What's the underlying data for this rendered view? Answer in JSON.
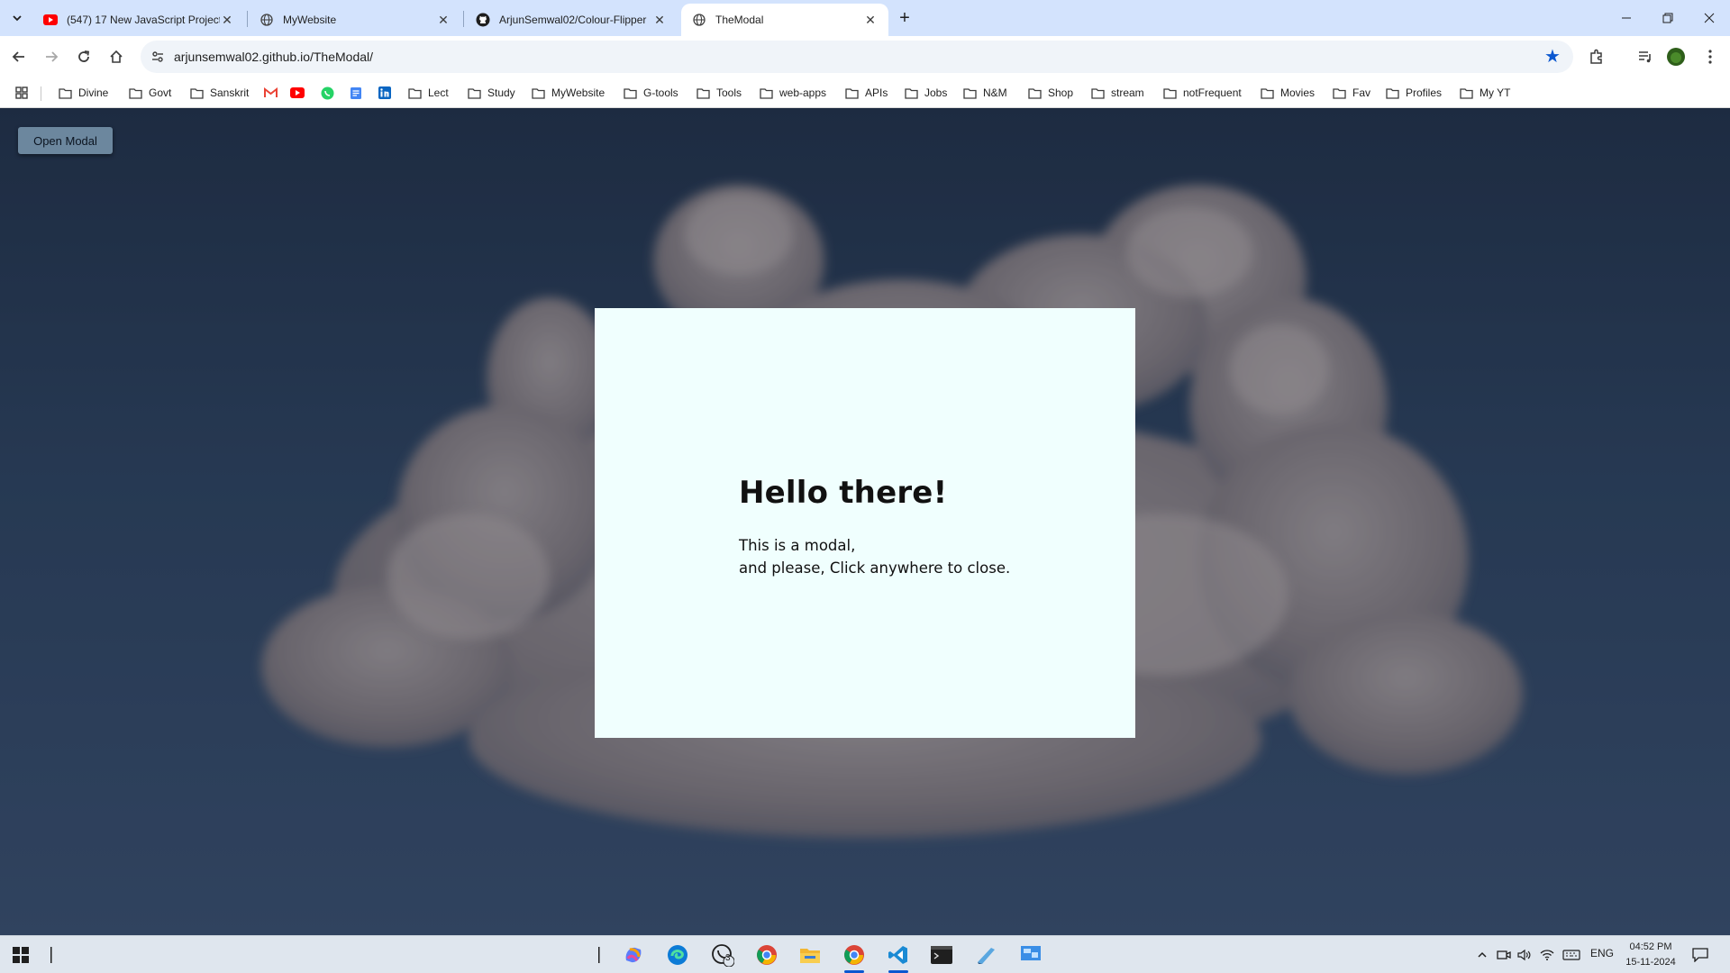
{
  "browser": {
    "tabs": [
      {
        "title": "(547) 17 New JavaScript Project",
        "icon": "youtube-icon"
      },
      {
        "title": "MyWebsite",
        "icon": "globe-icon"
      },
      {
        "title": "ArjunSemwal02/Colour-Flipper",
        "icon": "github-icon"
      },
      {
        "title": "TheModal",
        "icon": "globe-icon",
        "active": true
      }
    ],
    "url": "arjunsemwal02.github.io/TheModal/",
    "bookmarks": [
      "Divine",
      "Govt",
      "Sanskrit",
      "Lect",
      "Study",
      "MyWebsite",
      "G-tools",
      "Tools",
      "web-apps",
      "APIs",
      "Jobs",
      "N&M",
      "Shop",
      "stream",
      "notFrequent",
      "Movies",
      "Fav",
      "Profiles",
      "My YT"
    ]
  },
  "page": {
    "open_button": "Open Modal",
    "modal": {
      "heading": "Hello there!",
      "line1": "This is a modal,",
      "line2": "and please, Click anywhere to close."
    }
  },
  "taskbar": {
    "whatsapp_badge": "3",
    "language": "ENG",
    "time": "04:52 PM",
    "date": "15-11-2024"
  },
  "colors": {
    "tabstrip": "#d3e3fd",
    "modal_bg": "#f0fffe",
    "button_bg": "#6c879e",
    "accent": "#0b57d0"
  }
}
